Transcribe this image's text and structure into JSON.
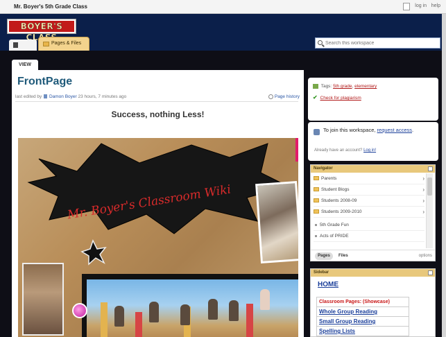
{
  "topbar": {
    "site_title": "Mr. Boyer's 5th Grade Class",
    "login": "log in",
    "help": "help"
  },
  "header": {
    "logo_text": "BOYER'S CLASS",
    "tab_pages_files": "Pages & Files",
    "search_placeholder": "Search this workspace"
  },
  "main": {
    "view_tab": "VIEW",
    "title": "FrontPage",
    "meta_prefix": "last edited by",
    "editor": "Damon Boyer",
    "meta_suffix": "23 hours, 7 minutes ago",
    "history": "Page history",
    "headline": "Success, nothing Less!",
    "banner_text": "Mr. Boyer's Classroom Wiki"
  },
  "tags": {
    "label": "Tags:",
    "tag1": "5th grade",
    "sep": ",",
    "tag2": "elementary",
    "plagiarism": "Check for plagiarism"
  },
  "join": {
    "text": "To join this workspace,",
    "link": "request access",
    "period": ".",
    "account_q": "Already have an account?",
    "login_link": "Log in!"
  },
  "navigator": {
    "title": "Navigator",
    "folders": [
      {
        "label": "Parents"
      },
      {
        "label": "Student Blogs"
      },
      {
        "label": "Students 2008-09"
      },
      {
        "label": "Students 2009-2010"
      }
    ],
    "pages": [
      {
        "label": "5th Grade Fun"
      },
      {
        "label": "Acts of PRIDE"
      }
    ],
    "pages_btn": "Pages",
    "files_btn": "Files",
    "options": "options"
  },
  "sidebar": {
    "title": "Sidebar",
    "home": "HOME",
    "items": [
      "Classroom Pages: (Showcase)",
      "Whole Group Reading",
      "Small Group Reading",
      "Spelling Lists"
    ]
  }
}
